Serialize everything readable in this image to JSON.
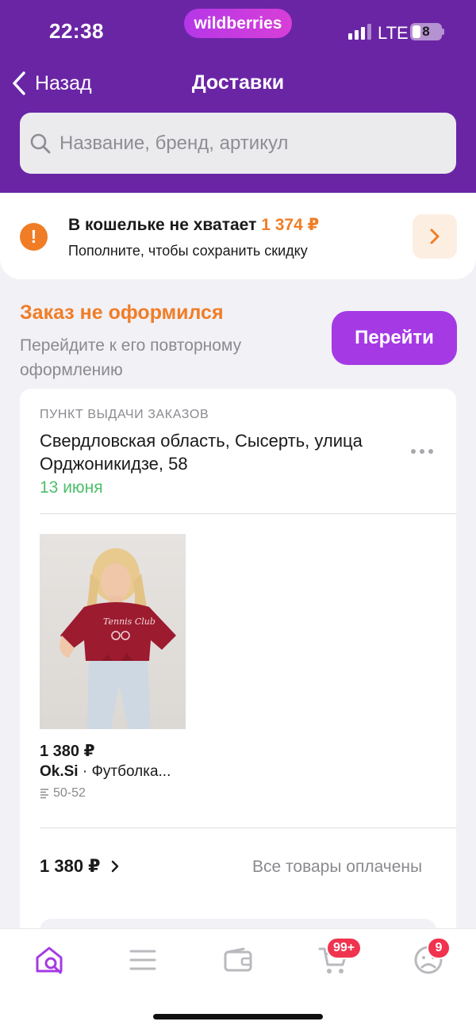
{
  "status_bar": {
    "time": "22:38",
    "brand": "wildberries",
    "network": "LTE",
    "battery": "8"
  },
  "nav": {
    "back_label": "Назад",
    "title": "Доставки"
  },
  "search": {
    "placeholder": "Название, бренд, артикул",
    "icon": "search-icon"
  },
  "wallet": {
    "title": "В кошельке не хватает ",
    "amount": "1 374 ₽",
    "subtitle": "Пополните, чтобы сохранить скидку",
    "icon": "warning-icon"
  },
  "order_alert": {
    "title": "Заказ не оформился",
    "subtitle": "Перейдите к его повторному оформлению",
    "button": "Перейти"
  },
  "delivery": {
    "pickup_label": "ПУНКТ ВЫДАЧИ ЗАКАЗОВ",
    "address": "Свердловская область, Сысерть, улица Орджоникидзе, 58",
    "date": "13 июня",
    "product": {
      "price": "1 380 ₽",
      "brand": "Ok.Si",
      "name": " · Футболка...",
      "size": "50-52",
      "image_text": "Tennis Club"
    },
    "total": "1 380 ₽",
    "status": "Все товары оплачены"
  },
  "tabbar": {
    "items": [
      "home-search-icon",
      "catalog-icon",
      "wallet-icon",
      "cart-icon",
      "profile-icon"
    ],
    "cart_badge": "99+",
    "profile_badge": "9"
  },
  "colors": {
    "header": "#6a25a5",
    "accent": "#a53ae4",
    "warning": "#f07d26",
    "success": "#4bbf6b",
    "badge": "#f0334f"
  }
}
